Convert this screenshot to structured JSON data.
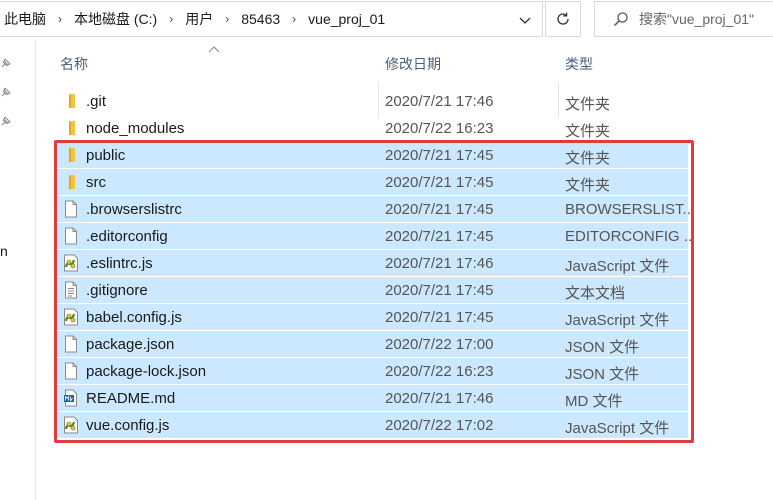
{
  "address_bar": {
    "breadcrumbs": [
      "此电脑",
      "本地磁盘 (C:)",
      "用户",
      "85463",
      "vue_proj_01"
    ]
  },
  "search": {
    "placeholder": "搜索\"vue_proj_01\""
  },
  "nav_pane": {
    "cut_text": "n"
  },
  "columns": {
    "name": "名称",
    "date": "修改日期",
    "type": "类型"
  },
  "files": [
    {
      "name": ".git",
      "date": "2020/7/21 17:46",
      "type": "文件夹",
      "icon": "folder-icon",
      "selected": false
    },
    {
      "name": "node_modules",
      "date": "2020/7/22 16:23",
      "type": "文件夹",
      "icon": "folder-icon",
      "selected": false
    },
    {
      "name": "public",
      "date": "2020/7/21 17:45",
      "type": "文件夹",
      "icon": "folder-icon",
      "selected": true
    },
    {
      "name": "src",
      "date": "2020/7/21 17:45",
      "type": "文件夹",
      "icon": "folder-icon",
      "selected": true
    },
    {
      "name": ".browserslistrc",
      "date": "2020/7/21 17:45",
      "type": "BROWSERSLIST...",
      "icon": "blank-file-icon",
      "selected": true
    },
    {
      "name": ".editorconfig",
      "date": "2020/7/21 17:45",
      "type": "EDITORCONFIG ...",
      "icon": "blank-file-icon",
      "selected": true
    },
    {
      "name": ".eslintrc.js",
      "date": "2020/7/21 17:46",
      "type": "JavaScript 文件",
      "icon": "js-file-icon",
      "selected": true
    },
    {
      "name": ".gitignore",
      "date": "2020/7/21 17:45",
      "type": "文本文档",
      "icon": "text-file-icon",
      "selected": true
    },
    {
      "name": "babel.config.js",
      "date": "2020/7/21 17:45",
      "type": "JavaScript 文件",
      "icon": "js-file-icon",
      "selected": true
    },
    {
      "name": "package.json",
      "date": "2020/7/22 17:00",
      "type": "JSON 文件",
      "icon": "blank-file-icon",
      "selected": true
    },
    {
      "name": "package-lock.json",
      "date": "2020/7/22 16:23",
      "type": "JSON 文件",
      "icon": "blank-file-icon",
      "selected": true
    },
    {
      "name": "README.md",
      "date": "2020/7/21 17:46",
      "type": "MD 文件",
      "icon": "md-file-icon",
      "selected": true
    },
    {
      "name": "vue.config.js",
      "date": "2020/7/22 17:02",
      "type": "JavaScript 文件",
      "icon": "js-file-icon",
      "selected": true
    }
  ],
  "colors": {
    "selection_bg": "#cce8ff",
    "highlight_outline": "#e23b3b",
    "folder": "#f5c242",
    "header_text": "#4c607a"
  }
}
